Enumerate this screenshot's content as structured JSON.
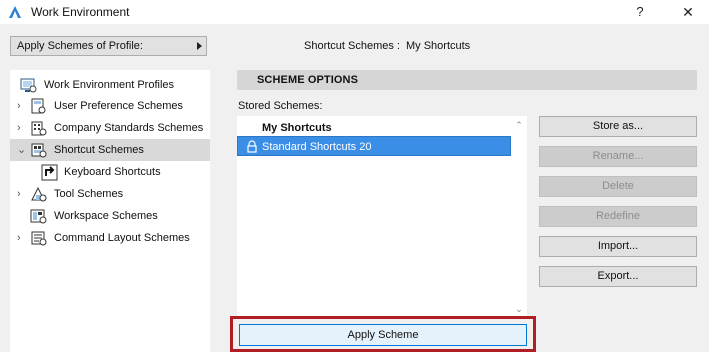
{
  "window": {
    "title": "Work Environment",
    "help_glyph": "?",
    "close_glyph": "✕"
  },
  "profile": {
    "button_label": "Apply Schemes of Profile:"
  },
  "header": {
    "caption_label": "Shortcut Schemes :",
    "caption_value": "My Shortcuts"
  },
  "tree": {
    "items": [
      {
        "label": "Work Environment Profiles",
        "icon": "profiles-icon",
        "expandable": false
      },
      {
        "label": "User Preference Schemes",
        "icon": "user-preferences-icon",
        "expandable": true,
        "chevron": "›"
      },
      {
        "label": "Company Standards Schemes",
        "icon": "company-standards-icon",
        "expandable": true,
        "chevron": "›"
      },
      {
        "label": "Shortcut Schemes",
        "icon": "shortcut-schemes-icon",
        "expandable": true,
        "chevron": "⌄",
        "selected": true
      },
      {
        "label": "Keyboard Shortcuts",
        "icon": "keyboard-shortcuts-icon",
        "expandable": false,
        "child": true
      },
      {
        "label": "Tool Schemes",
        "icon": "tool-schemes-icon",
        "expandable": true,
        "chevron": "›"
      },
      {
        "label": "Workspace Schemes",
        "icon": "workspace-schemes-icon",
        "expandable": false
      },
      {
        "label": "Command Layout Schemes",
        "icon": "command-layout-icon",
        "expandable": true,
        "chevron": "›"
      }
    ]
  },
  "scheme_options": {
    "title": "SCHEME OPTIONS",
    "stored_label": "Stored Schemes:",
    "group_label": "My Shortcuts",
    "selected_scheme": "Standard Shortcuts 20",
    "scroll_up_glyph": "⌃",
    "scroll_down_glyph": "⌄"
  },
  "buttons": {
    "store_as": "Store as...",
    "rename": "Rename...",
    "delete": "Delete",
    "redefine": "Redefine",
    "import": "Import...",
    "export": "Export...",
    "apply_scheme": "Apply Scheme"
  },
  "colors": {
    "selection_blue": "#3a8ee6",
    "highlight_red": "#b01e23",
    "app_icon_blue": "#2d7fd3"
  }
}
